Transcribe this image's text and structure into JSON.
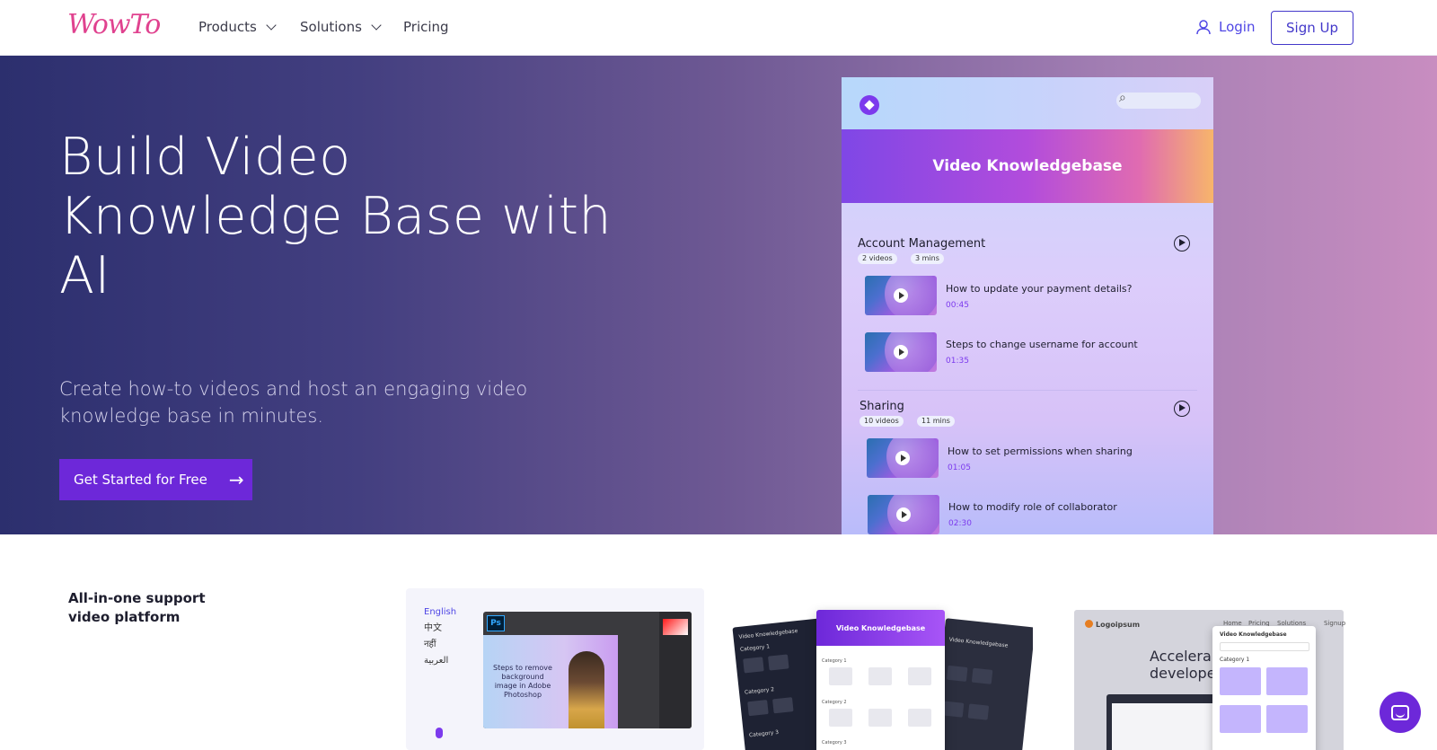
{
  "nav": {
    "logo": "WowTo",
    "products": "Products",
    "solutions": "Solutions",
    "pricing": "Pricing",
    "login": "Login",
    "signup": "Sign Up"
  },
  "hero": {
    "title": "Build Video Knowledge Base with AI",
    "subtitle": "Create how-to videos and host an engaging video knowledge base in minutes.",
    "cta": "Get Started for Free",
    "cta_icon": "arrow-right-icon"
  },
  "kb": {
    "banner": "Video Knowledgebase",
    "sections": [
      {
        "title": "Account Management",
        "videos_count": "2 videos",
        "duration": "3 mins",
        "videos": [
          {
            "title": "How to update your payment details?",
            "duration": "00:45"
          },
          {
            "title": "Steps to change username for account",
            "duration": "01:35"
          }
        ]
      },
      {
        "title": "Sharing",
        "videos_count": "10 videos",
        "duration": "11 mins",
        "videos": [
          {
            "title": "How to set permissions when sharing",
            "duration": "01:05"
          },
          {
            "title": "How to modify role of collaborator",
            "duration": "02:30"
          }
        ]
      }
    ]
  },
  "platform": {
    "label": "All-in-one support video platform"
  },
  "card1": {
    "languages": [
      "English",
      "中文",
      "नहीं",
      "العربية"
    ],
    "ps_badge": "Ps",
    "canvas_text": "Steps to remove background image in Adobe Photoshop"
  },
  "card2": {
    "title": "Video Knowledgebase",
    "side_title": "Video Knowledgebase",
    "category1": "Category 1",
    "category2": "Category 2",
    "category3": "Category 3"
  },
  "card3": {
    "brand": "Logoipsum",
    "menu": [
      "Home",
      "Pricing",
      "Solutions",
      "Signup"
    ],
    "headline_1": "Accelera",
    "headline_2": "developer",
    "modal_title": "Video Knowledgebase",
    "modal_category": "Category 1"
  },
  "colors": {
    "accent": "#6d28d9",
    "brand_pink": "#e0428f",
    "link_indigo": "#4f46e5"
  }
}
